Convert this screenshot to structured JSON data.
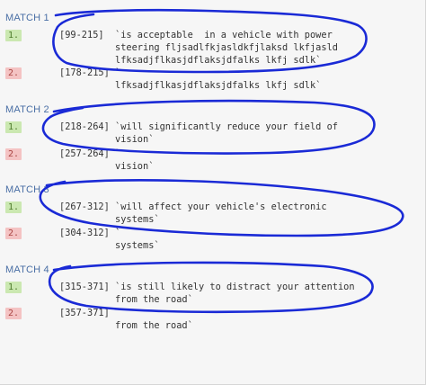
{
  "matches": [
    {
      "title": "MATCH 1",
      "rows": [
        {
          "index": "1.",
          "range": "[99-215]",
          "lines": [
            "`is acceptable  in a vehicle with power",
            "steering fljsadlfkjasldkfjlaksd lkfjasld",
            "lfksadjflkasjdflaksjdfalks lkfj sdlk`"
          ]
        },
        {
          "index": "2.",
          "range": "[178-215]",
          "lines": [
            "`",
            "lfksadjflkasjdflaksjdfalks lkfj sdlk`"
          ]
        }
      ]
    },
    {
      "title": "MATCH 2",
      "rows": [
        {
          "index": "1.",
          "range": "[218-264]",
          "lines": [
            "`will significantly reduce your field of",
            "vision`"
          ]
        },
        {
          "index": "2.",
          "range": "[257-264]",
          "lines": [
            "`",
            "vision`"
          ]
        }
      ]
    },
    {
      "title": "MATCH 3",
      "rows": [
        {
          "index": "1.",
          "range": "[267-312]",
          "lines": [
            "`will affect your vehicle's electronic",
            "systems`"
          ]
        },
        {
          "index": "2.",
          "range": "[304-312]",
          "lines": [
            "`",
            "systems`"
          ]
        }
      ]
    },
    {
      "title": "MATCH 4",
      "rows": [
        {
          "index": "1.",
          "range": "[315-371]",
          "lines": [
            "`is still likely to distract your attention",
            "from the road`"
          ]
        },
        {
          "index": "2.",
          "range": "[357-371]",
          "lines": [
            "`",
            "from the road`"
          ]
        }
      ]
    }
  ],
  "colors": {
    "title": "#4a6fa5",
    "badge_1_bg": "#cbe8b1",
    "badge_2_bg": "#f4c3c3",
    "annotation_ink": "#1a2ad6"
  }
}
